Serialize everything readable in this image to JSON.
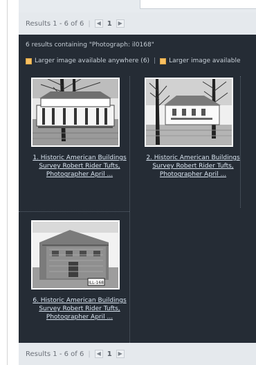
{
  "pager": {
    "text": "Results 1 - 6 of 6",
    "page": "1"
  },
  "summary": "6 results containing \"Photograph: il0168\"",
  "filters": {
    "option1": "Larger image available anywhere (6)",
    "option2": "Larger image available"
  },
  "cards": [
    {
      "number": "1.",
      "title": "Historic American Buildings Survey Robert Rider Tufts, Photographer April ..."
    },
    {
      "number": "2.",
      "title": "Historic American Buildings Survey Robert Rider Tufts, Photographer April ..."
    },
    {
      "number": "6.",
      "title": "Historic American Buildings Survey Robert Rider Tufts, Photographer April ..."
    }
  ],
  "photo_tags": {
    "card3": "ILL-168"
  },
  "colors": {
    "panel": "#252c35",
    "pager": "#e5e9ed",
    "link": "#d9e4f0",
    "checkbox": "#f9c061"
  }
}
